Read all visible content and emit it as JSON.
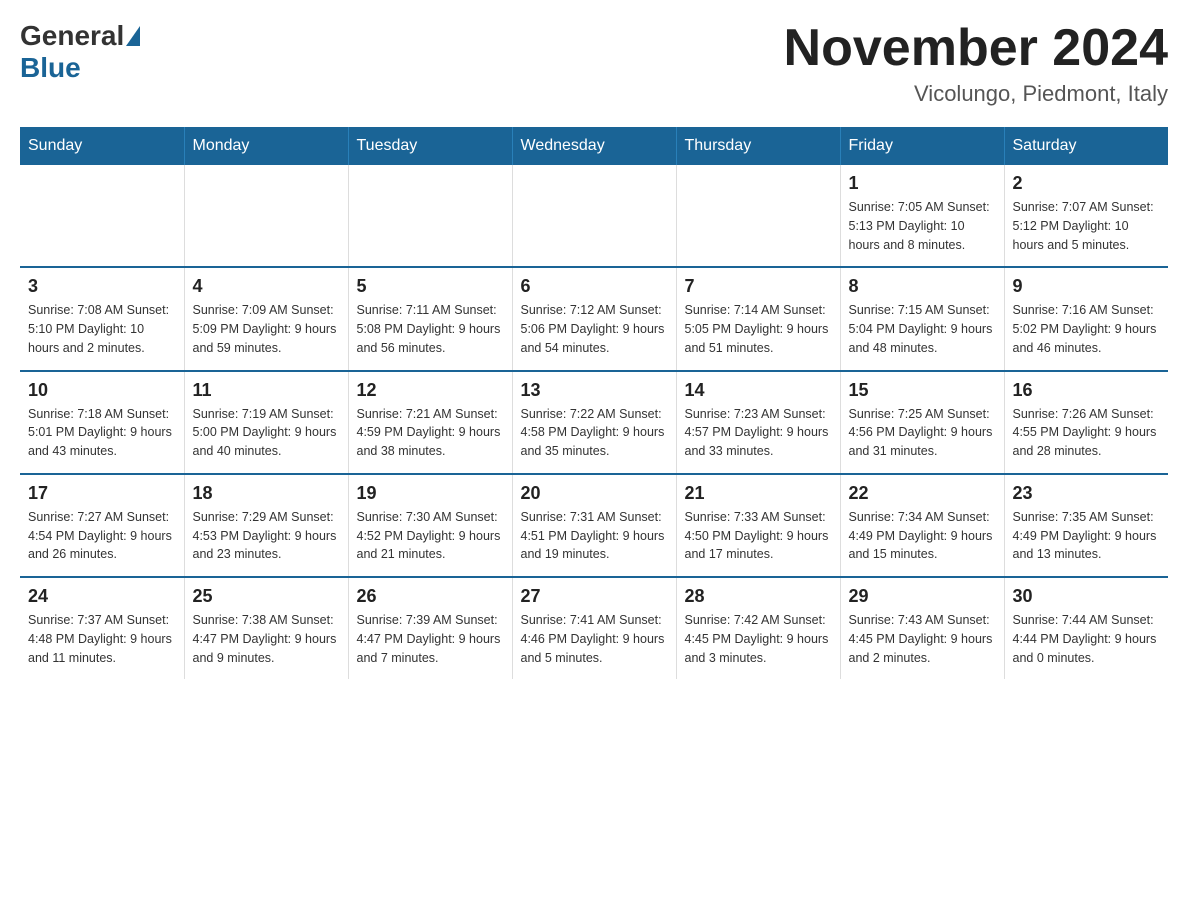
{
  "header": {
    "logo": {
      "general": "General",
      "blue": "Blue"
    },
    "title": "November 2024",
    "location": "Vicolungo, Piedmont, Italy"
  },
  "weekdays": [
    "Sunday",
    "Monday",
    "Tuesday",
    "Wednesday",
    "Thursday",
    "Friday",
    "Saturday"
  ],
  "weeks": [
    [
      {
        "day": "",
        "info": ""
      },
      {
        "day": "",
        "info": ""
      },
      {
        "day": "",
        "info": ""
      },
      {
        "day": "",
        "info": ""
      },
      {
        "day": "",
        "info": ""
      },
      {
        "day": "1",
        "info": "Sunrise: 7:05 AM\nSunset: 5:13 PM\nDaylight: 10 hours and 8 minutes."
      },
      {
        "day": "2",
        "info": "Sunrise: 7:07 AM\nSunset: 5:12 PM\nDaylight: 10 hours and 5 minutes."
      }
    ],
    [
      {
        "day": "3",
        "info": "Sunrise: 7:08 AM\nSunset: 5:10 PM\nDaylight: 10 hours and 2 minutes."
      },
      {
        "day": "4",
        "info": "Sunrise: 7:09 AM\nSunset: 5:09 PM\nDaylight: 9 hours and 59 minutes."
      },
      {
        "day": "5",
        "info": "Sunrise: 7:11 AM\nSunset: 5:08 PM\nDaylight: 9 hours and 56 minutes."
      },
      {
        "day": "6",
        "info": "Sunrise: 7:12 AM\nSunset: 5:06 PM\nDaylight: 9 hours and 54 minutes."
      },
      {
        "day": "7",
        "info": "Sunrise: 7:14 AM\nSunset: 5:05 PM\nDaylight: 9 hours and 51 minutes."
      },
      {
        "day": "8",
        "info": "Sunrise: 7:15 AM\nSunset: 5:04 PM\nDaylight: 9 hours and 48 minutes."
      },
      {
        "day": "9",
        "info": "Sunrise: 7:16 AM\nSunset: 5:02 PM\nDaylight: 9 hours and 46 minutes."
      }
    ],
    [
      {
        "day": "10",
        "info": "Sunrise: 7:18 AM\nSunset: 5:01 PM\nDaylight: 9 hours and 43 minutes."
      },
      {
        "day": "11",
        "info": "Sunrise: 7:19 AM\nSunset: 5:00 PM\nDaylight: 9 hours and 40 minutes."
      },
      {
        "day": "12",
        "info": "Sunrise: 7:21 AM\nSunset: 4:59 PM\nDaylight: 9 hours and 38 minutes."
      },
      {
        "day": "13",
        "info": "Sunrise: 7:22 AM\nSunset: 4:58 PM\nDaylight: 9 hours and 35 minutes."
      },
      {
        "day": "14",
        "info": "Sunrise: 7:23 AM\nSunset: 4:57 PM\nDaylight: 9 hours and 33 minutes."
      },
      {
        "day": "15",
        "info": "Sunrise: 7:25 AM\nSunset: 4:56 PM\nDaylight: 9 hours and 31 minutes."
      },
      {
        "day": "16",
        "info": "Sunrise: 7:26 AM\nSunset: 4:55 PM\nDaylight: 9 hours and 28 minutes."
      }
    ],
    [
      {
        "day": "17",
        "info": "Sunrise: 7:27 AM\nSunset: 4:54 PM\nDaylight: 9 hours and 26 minutes."
      },
      {
        "day": "18",
        "info": "Sunrise: 7:29 AM\nSunset: 4:53 PM\nDaylight: 9 hours and 23 minutes."
      },
      {
        "day": "19",
        "info": "Sunrise: 7:30 AM\nSunset: 4:52 PM\nDaylight: 9 hours and 21 minutes."
      },
      {
        "day": "20",
        "info": "Sunrise: 7:31 AM\nSunset: 4:51 PM\nDaylight: 9 hours and 19 minutes."
      },
      {
        "day": "21",
        "info": "Sunrise: 7:33 AM\nSunset: 4:50 PM\nDaylight: 9 hours and 17 minutes."
      },
      {
        "day": "22",
        "info": "Sunrise: 7:34 AM\nSunset: 4:49 PM\nDaylight: 9 hours and 15 minutes."
      },
      {
        "day": "23",
        "info": "Sunrise: 7:35 AM\nSunset: 4:49 PM\nDaylight: 9 hours and 13 minutes."
      }
    ],
    [
      {
        "day": "24",
        "info": "Sunrise: 7:37 AM\nSunset: 4:48 PM\nDaylight: 9 hours and 11 minutes."
      },
      {
        "day": "25",
        "info": "Sunrise: 7:38 AM\nSunset: 4:47 PM\nDaylight: 9 hours and 9 minutes."
      },
      {
        "day": "26",
        "info": "Sunrise: 7:39 AM\nSunset: 4:47 PM\nDaylight: 9 hours and 7 minutes."
      },
      {
        "day": "27",
        "info": "Sunrise: 7:41 AM\nSunset: 4:46 PM\nDaylight: 9 hours and 5 minutes."
      },
      {
        "day": "28",
        "info": "Sunrise: 7:42 AM\nSunset: 4:45 PM\nDaylight: 9 hours and 3 minutes."
      },
      {
        "day": "29",
        "info": "Sunrise: 7:43 AM\nSunset: 4:45 PM\nDaylight: 9 hours and 2 minutes."
      },
      {
        "day": "30",
        "info": "Sunrise: 7:44 AM\nSunset: 4:44 PM\nDaylight: 9 hours and 0 minutes."
      }
    ]
  ]
}
